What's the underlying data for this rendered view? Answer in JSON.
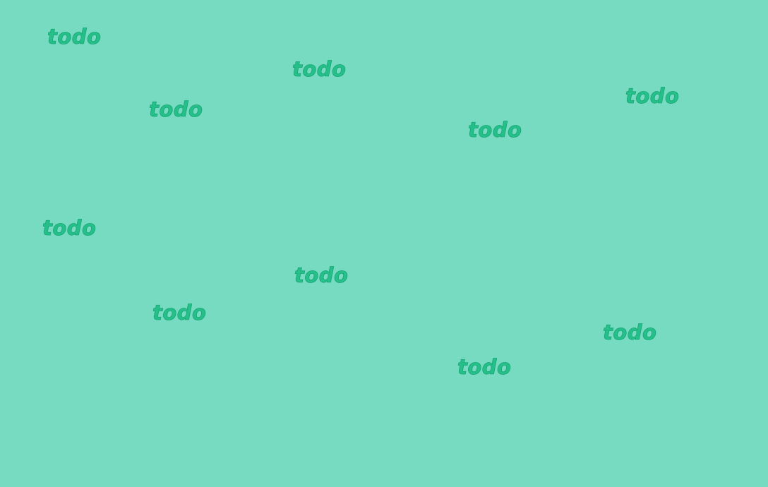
{
  "background_color": "#77dbc2",
  "watermark_color": "#25c08a",
  "watermarks": [
    {
      "text": "todo"
    },
    {
      "text": "todo"
    },
    {
      "text": "todo"
    },
    {
      "text": "todo"
    },
    {
      "text": "todo"
    },
    {
      "text": "todo"
    },
    {
      "text": "todo"
    },
    {
      "text": "todo"
    },
    {
      "text": "todo"
    },
    {
      "text": "todo"
    }
  ]
}
